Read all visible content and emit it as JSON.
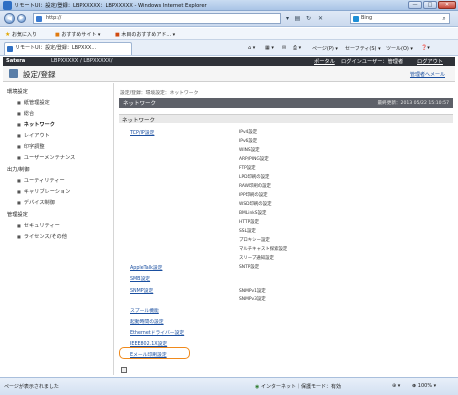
{
  "window": {
    "title": "リモートUI：設定/登録：LBPXXXXX：LBPXXXXX - Windows Internet Explorer",
    "minimize": "—",
    "maximize": "□",
    "close": "✕"
  },
  "browser": {
    "address": "http://",
    "search_text": "Bing",
    "favorites_label": "お気に入り",
    "fav_items": [
      "おすすめサイト ▾",
      "木目のおすすめアド... ▾"
    ],
    "tab_title": "リモートUI：設定/登録：LBPXXX...",
    "commands": [
      "ページ(P) ▾",
      "セーフティ(S) ▾",
      "ツール(O) ▾"
    ]
  },
  "remote_header": {
    "brand": "Satera",
    "device": "LBPXXXXX / LBPXXXXX/",
    "portal": "ポータル",
    "login_user": "ログインユーザー：管理者",
    "logout": "ログアウト"
  },
  "page": {
    "title": "設定/登録",
    "manager_link": "管理者へメール"
  },
  "sidebar": {
    "sections": [
      {
        "label": "環境設定",
        "items": [
          "紙管理設定",
          "総合",
          "ネットワーク",
          "レイアウト",
          "印字調整",
          "ユーザーメンテナンス"
        ]
      },
      {
        "label": "出力/制御",
        "items": [
          "ユーティリティー",
          "キャリブレーション",
          "デバイス制御"
        ]
      },
      {
        "label": "管理設定",
        "items": [
          "セキュリティー",
          "ライセンス/その他"
        ]
      }
    ],
    "active": "ネットワーク"
  },
  "main": {
    "breadcrumb": "設定/登録：環境設定：ネットワーク",
    "section_title": "ネットワーク",
    "updated": "最終更新：2013 05/22 15:10:57",
    "box_title": "ネットワーク",
    "tcpip_link": "TCP/IP設定",
    "tcpip_items": [
      "IPv4設定",
      "IPv6設定",
      "WINS設定",
      "ARP/PING設定",
      "FTP設定",
      "LPD印刷の設定",
      "RAW印刷の設定",
      "IPP印刷の設定",
      "WSD印刷の設定",
      "BMLinkS設定",
      "HTTP設定",
      "SSL設定",
      "プロキシー設定",
      "マルチキャスト探索設定",
      "スリープ通知設定",
      "SNTP設定"
    ],
    "appletalk_link": "AppleTalk設定",
    "smb_link": "SMB設定",
    "snmp_link": "SNMP設定",
    "snmp_items": [
      "SNMPv1設定",
      "SNMPv3設定"
    ],
    "bottom_links": [
      "スプール機能",
      "起動時間の設定",
      "Ethernetドライバー設定",
      "IEEE802.1X設定",
      "Eメール印刷設定"
    ]
  },
  "statusbar": {
    "left": "ページが表示されました",
    "zone": "インターネット｜保護モード：有効",
    "zoom": "100%"
  }
}
